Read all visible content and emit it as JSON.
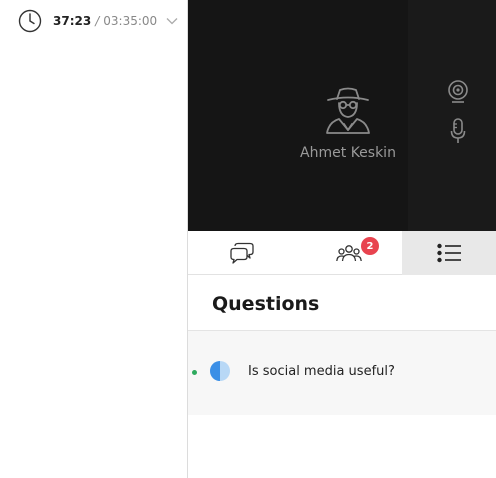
{
  "timer": {
    "elapsed": "37:23",
    "separator": "/",
    "total": "03:35:00",
    "icon": "clock-icon",
    "dropdown_icon": "chevron-down-icon"
  },
  "video": {
    "participant_name": "Ahmet Keskin",
    "avatar_icon": "incognito-avatar-icon",
    "camera_icon": "webcam-icon",
    "mic_icon": "microphone-icon"
  },
  "tabs": [
    {
      "icon": "chat-bubbles-icon",
      "active": false
    },
    {
      "icon": "participants-icon",
      "badge": "2",
      "active": false
    },
    {
      "icon": "list-icon",
      "active": true
    }
  ],
  "questions": {
    "title": "Questions",
    "items": [
      {
        "text": "Is social media useful?",
        "status_color": "#2eaa5e",
        "progress_fraction": 0.5
      }
    ]
  },
  "colors": {
    "video_bg": "#151515",
    "badge_bg": "#e8434f",
    "active_tab_bg": "#e8e8e8",
    "question_icon_blue": "#3b8fe6",
    "question_icon_light": "#b8d8f6"
  }
}
